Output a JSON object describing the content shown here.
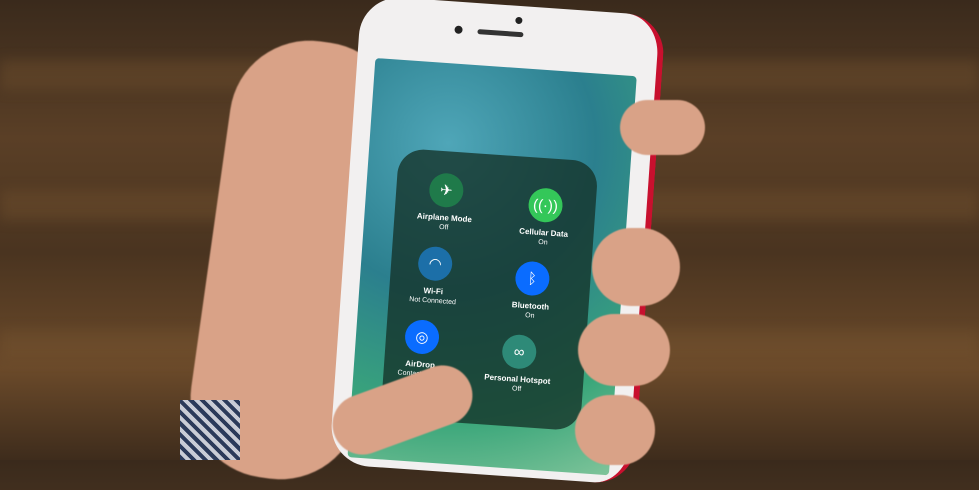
{
  "control_center": {
    "tiles": [
      {
        "label": "Airplane Mode",
        "status": "Off",
        "icon": "airplane-icon",
        "color": "#1f7a4a"
      },
      {
        "label": "Cellular Data",
        "status": "On",
        "icon": "antenna-icon",
        "color": "#34c759"
      },
      {
        "label": "Wi-Fi",
        "status": "Not Connected",
        "icon": "wifi-icon",
        "color": "#1c6fa8"
      },
      {
        "label": "Bluetooth",
        "status": "On",
        "icon": "bluetooth-icon",
        "color": "#0a6cff"
      },
      {
        "label": "AirDrop",
        "status": "Contacts Only",
        "icon": "airdrop-icon",
        "color": "#0a6cff"
      },
      {
        "label": "Personal Hotspot",
        "status": "Off",
        "icon": "hotspot-icon",
        "color": "#2e8a78"
      }
    ]
  },
  "colors": {
    "phone_accent": "#c8102e"
  }
}
